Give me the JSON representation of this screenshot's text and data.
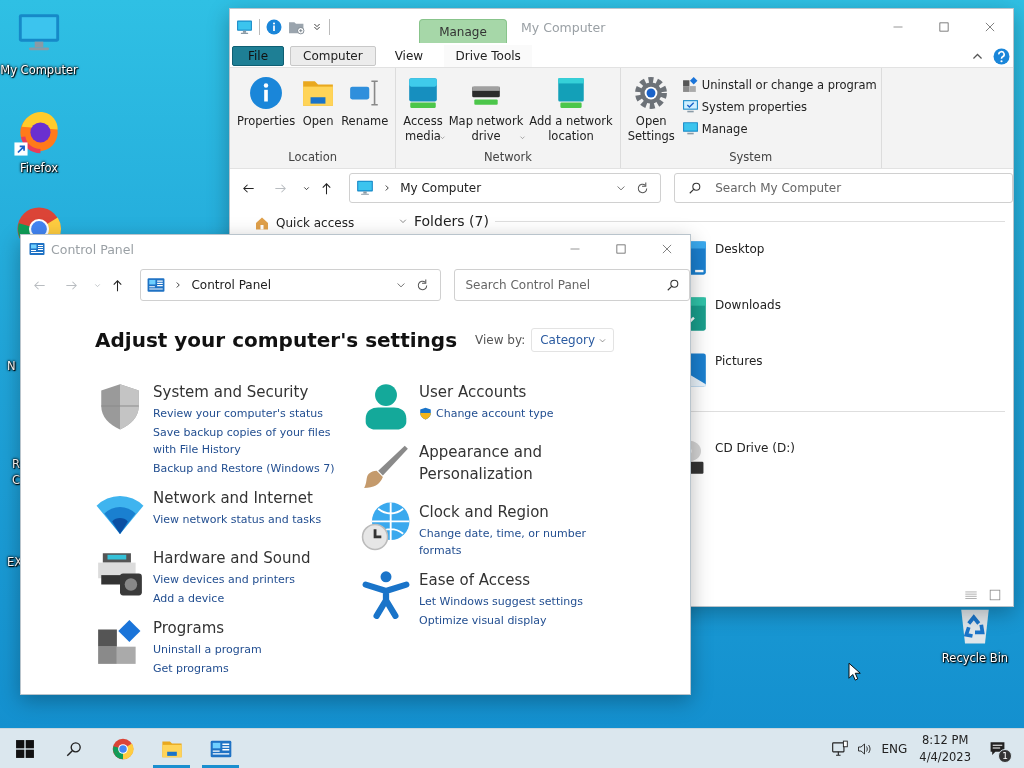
{
  "desktop": {
    "icons": [
      {
        "kind": "computer",
        "label": "My Computer"
      },
      {
        "kind": "firefox",
        "label": "Firefox",
        "shortcut": true
      },
      {
        "kind": "chrome"
      },
      {
        "kind": "covered",
        "label": "N"
      },
      {
        "kind": "covered",
        "label": "R\nC"
      },
      {
        "kind": "covered",
        "label": "EX"
      }
    ],
    "recycle_bin": {
      "label": "Recycle Bin"
    }
  },
  "explorer": {
    "context_tab": "Manage",
    "title": "My Computer",
    "tabs": [
      {
        "label": "File",
        "kind": "file",
        "selected": false
      },
      {
        "label": "Computer",
        "kind": "tab",
        "selected": true
      },
      {
        "label": "View",
        "kind": "tab",
        "selected": false
      },
      {
        "label": "Drive Tools",
        "kind": "context",
        "selected": false
      }
    ],
    "ribbon_groups": [
      {
        "name": "Location",
        "buttons": [
          {
            "label": "Properties",
            "kind": "info",
            "dropdown": false
          },
          {
            "label": "Open",
            "kind": "folder",
            "dropdown": false
          },
          {
            "label": "Rename",
            "kind": "rename",
            "dropdown": false
          }
        ]
      },
      {
        "name": "Network",
        "buttons": [
          {
            "label": "Access\nmedia",
            "kind": "media",
            "dropdown": true
          },
          {
            "label": "Map network\ndrive",
            "kind": "netdrive",
            "dropdown": true
          },
          {
            "label": "Add a network\nlocation",
            "kind": "netloc",
            "dropdown": false
          }
        ]
      },
      {
        "name": "System",
        "buttons": [
          {
            "label": "Open\nSettings",
            "kind": "gear",
            "dropdown": false
          }
        ],
        "small_buttons": [
          {
            "label": "Uninstall or change a program",
            "kind": "programs"
          },
          {
            "label": "System properties",
            "kind": "sysprops"
          },
          {
            "label": "Manage",
            "kind": "manage"
          }
        ]
      }
    ],
    "nav_buttons": [
      {
        "kind": "back",
        "disabled": false
      },
      {
        "kind": "forward",
        "disabled": true
      },
      {
        "kind": "recent",
        "disabled": false
      },
      {
        "kind": "up",
        "disabled": false
      }
    ],
    "address": "My Computer",
    "search": {
      "placeholder": "Search My Computer"
    },
    "navigation": [
      {
        "label": "Quick access"
      }
    ],
    "sections": [
      {
        "title": "Folders (7)",
        "expanded": true,
        "items": [
          {
            "name": "Desktop",
            "kind": "desktopfolder"
          },
          {
            "name": "Downloads",
            "kind": "downloads"
          },
          {
            "name": "Pictures",
            "kind": "pictures"
          }
        ]
      },
      {
        "items": [
          {
            "name": "CD Drive (D:)",
            "kind": "cd"
          }
        ]
      }
    ]
  },
  "control_panel": {
    "title": "Control Panel",
    "nav_buttons": [
      {
        "kind": "back",
        "disabled": true
      },
      {
        "kind": "forward",
        "disabled": true
      },
      {
        "kind": "recent",
        "disabled": true
      },
      {
        "kind": "up",
        "disabled": false
      }
    ],
    "address": "Control Panel",
    "search": {
      "placeholder": "Search Control Panel"
    },
    "heading": "Adjust your computer's settings",
    "view_by": {
      "label": "View by:",
      "value": "Category"
    },
    "columns": [
      {
        "categories": [
          {
            "title": "System and Security",
            "kind": "shieldbig",
            "links": [
              {
                "text": "Review your computer's status"
              },
              {
                "text": "Save backup copies of your files\nwith File History"
              },
              {
                "text": "Backup and Restore (Windows 7)"
              }
            ]
          },
          {
            "title": "Network and Internet",
            "kind": "wifi",
            "links": [
              {
                "text": "View network status and tasks"
              }
            ]
          },
          {
            "title": "Hardware and Sound",
            "kind": "printer",
            "links": [
              {
                "text": "View devices and printers"
              },
              {
                "text": "Add a device"
              }
            ]
          },
          {
            "title": "Programs",
            "kind": "tiles",
            "links": [
              {
                "text": "Uninstall a program"
              },
              {
                "text": "Get programs"
              }
            ]
          }
        ]
      },
      {
        "categories": [
          {
            "title": "User Accounts",
            "kind": "user",
            "links": [
              {
                "text": "Change account type",
                "shield": true
              }
            ]
          },
          {
            "title": "Appearance and\nPersonalization",
            "kind": "brush"
          },
          {
            "title": "Clock and Region",
            "kind": "globe",
            "links": [
              {
                "text": "Change date, time, or number\nformats"
              }
            ]
          },
          {
            "title": "Ease of Access",
            "kind": "access",
            "links": [
              {
                "text": "Let Windows suggest settings"
              },
              {
                "text": "Optimize visual display"
              }
            ]
          }
        ]
      }
    ]
  },
  "taskbar": {
    "items": [
      {
        "kind": "start",
        "open": false
      },
      {
        "kind": "search",
        "open": false
      },
      {
        "kind": "chrome",
        "open": false
      },
      {
        "kind": "explorer",
        "open": true
      },
      {
        "kind": "controlpanel",
        "open": true
      }
    ],
    "language": "ENG",
    "time": "8:12 PM",
    "date": "4/4/2023",
    "notifications": "1"
  }
}
